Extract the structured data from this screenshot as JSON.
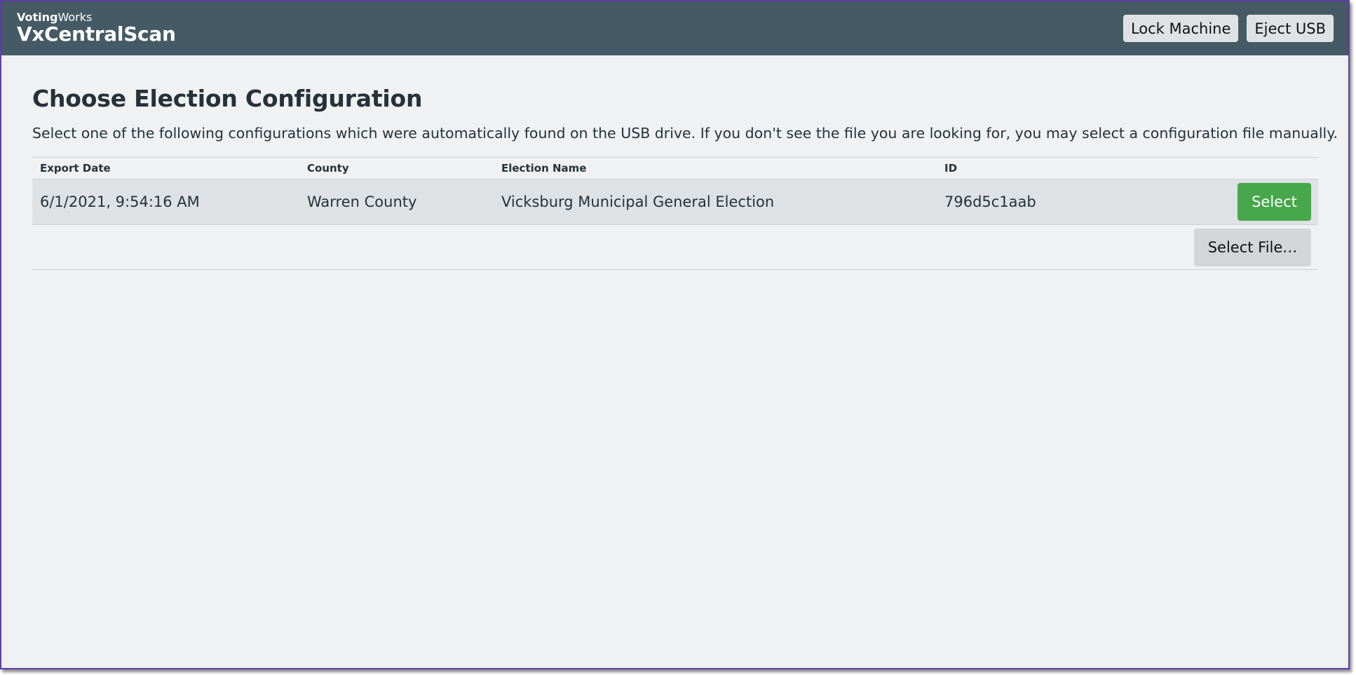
{
  "header": {
    "org_bold": "Voting",
    "org_regular": "Works",
    "app_name": "VxCentralScan",
    "lock_label": "Lock Machine",
    "eject_label": "Eject USB"
  },
  "main": {
    "title": "Choose Election Configuration",
    "description": "Select one of the following configurations which were automatically found on the USB drive. If you don't see the file you are looking for, you may select a configuration file manually.",
    "columns": [
      "Export Date",
      "County",
      "Election Name",
      "ID"
    ],
    "rows": [
      {
        "export_date": "6/1/2021, 9:54:16 AM",
        "county": "Warren County",
        "election_name": "Vicksburg Municipal General Election",
        "id": "796d5c1aab",
        "select_label": "Select"
      }
    ],
    "select_file_label": "Select File…"
  },
  "colors": {
    "topbar": "#455a64",
    "background": "#eff1f3",
    "primary_button": "#47a74b"
  }
}
